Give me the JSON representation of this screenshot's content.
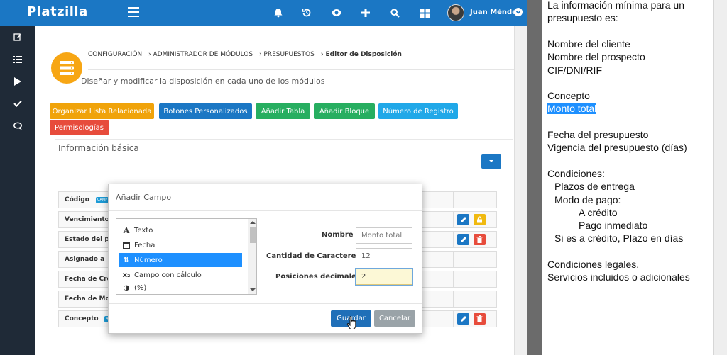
{
  "app": {
    "logo": "Platzilla",
    "user_name": "Juan Méndez",
    "top_icons": [
      "bell-icon",
      "history-icon",
      "eye-icon",
      "plus-icon",
      "search-icon",
      "grid-icon"
    ],
    "sidebar_icons": [
      "edit-icon",
      "list-icon",
      "play-icon",
      "check-icon",
      "chat-icon"
    ]
  },
  "breadcrumb": {
    "items": [
      "CONFIGURACIÓN",
      "› ADMINISTRADOR DE MÓDULOS",
      "› PRESUPUESTOS",
      "› Editor de Disposición"
    ]
  },
  "page": {
    "description": "Diseñar y modificar la disposición en cada uno de los módulos"
  },
  "actions": [
    {
      "label": "Organizar Lista Relacionada",
      "color": "#f0a30a"
    },
    {
      "label": "Botones Personalizados",
      "color": "#1b77c4"
    },
    {
      "label": "Añadir Tabla",
      "color": "#27ae60"
    },
    {
      "label": "Añadir Bloque",
      "color": "#27ae60"
    },
    {
      "label": "Número de Registro",
      "color": "#20a8e8"
    },
    {
      "label": "Permisologías",
      "color": "#e74c3c"
    }
  ],
  "section": {
    "title": "Información básica",
    "rows": [
      {
        "label": "Código",
        "tag": "CAMP"
      },
      {
        "label": "Vencimiento"
      },
      {
        "label": "Estado del pr"
      },
      {
        "label": "Asignado a"
      },
      {
        "label": "Fecha de Cre"
      },
      {
        "label": "Fecha de Mod"
      },
      {
        "label": "Concepto",
        "tag": "A"
      }
    ]
  },
  "modal": {
    "title": "Añadir Campo",
    "types": [
      {
        "label": "Texto",
        "icon": "text-icon",
        "glyph": "A"
      },
      {
        "label": "Fecha",
        "icon": "calendar-icon",
        "glyph": "▭"
      },
      {
        "label": "Número",
        "icon": "number-sort-icon",
        "glyph": "⇅"
      },
      {
        "label": "Campo con cálculo",
        "icon": "subscript-icon",
        "glyph": "x₂"
      },
      {
        "label": "(%)",
        "icon": "percent-circle-icon",
        "glyph": "◑"
      }
    ],
    "selected_type": "Número",
    "fields": {
      "name_label": "Nombre",
      "name_placeholder": "Monto total",
      "chars_label": "Cantidad de Caracteres",
      "chars_value": "12",
      "decimals_label": "Posiciones decimales",
      "decimals_value": "2"
    },
    "save_label": "Guardar",
    "cancel_label": "Cancelar"
  },
  "document": {
    "lines": [
      {
        "text": "La información mínima para un",
        "indent": 0
      },
      {
        "text": "presupuesto es:",
        "indent": 0
      },
      {
        "text": "",
        "indent": 0
      },
      {
        "text": "Nombre del cliente",
        "indent": 0
      },
      {
        "text": "Nombre del prospecto",
        "indent": 0
      },
      {
        "text": "CIF/DNI/RIF",
        "indent": 0
      },
      {
        "text": "",
        "indent": 0
      },
      {
        "text": "Concepto",
        "indent": 0
      },
      {
        "text": "Monto total",
        "indent": 0,
        "highlight": true
      },
      {
        "text": "",
        "indent": 0
      },
      {
        "text": "Fecha del presupuesto",
        "indent": 0
      },
      {
        "text": "Vigencia del presupuesto (días)",
        "indent": 0
      },
      {
        "text": "",
        "indent": 0
      },
      {
        "text": "Condiciones:",
        "indent": 0
      },
      {
        "text": "Plazos de entrega",
        "indent": 1
      },
      {
        "text": "Modo de pago:",
        "indent": 1
      },
      {
        "text": "A crédito",
        "indent": 2
      },
      {
        "text": "Pago inmediato",
        "indent": 2
      },
      {
        "text": "Si es a crédito, Plazo en días",
        "indent": 1
      },
      {
        "text": "",
        "indent": 0
      },
      {
        "text": "Condiciones legales.",
        "indent": 0
      },
      {
        "text": "Servicios incluidos o adicionales",
        "indent": 0
      }
    ]
  }
}
